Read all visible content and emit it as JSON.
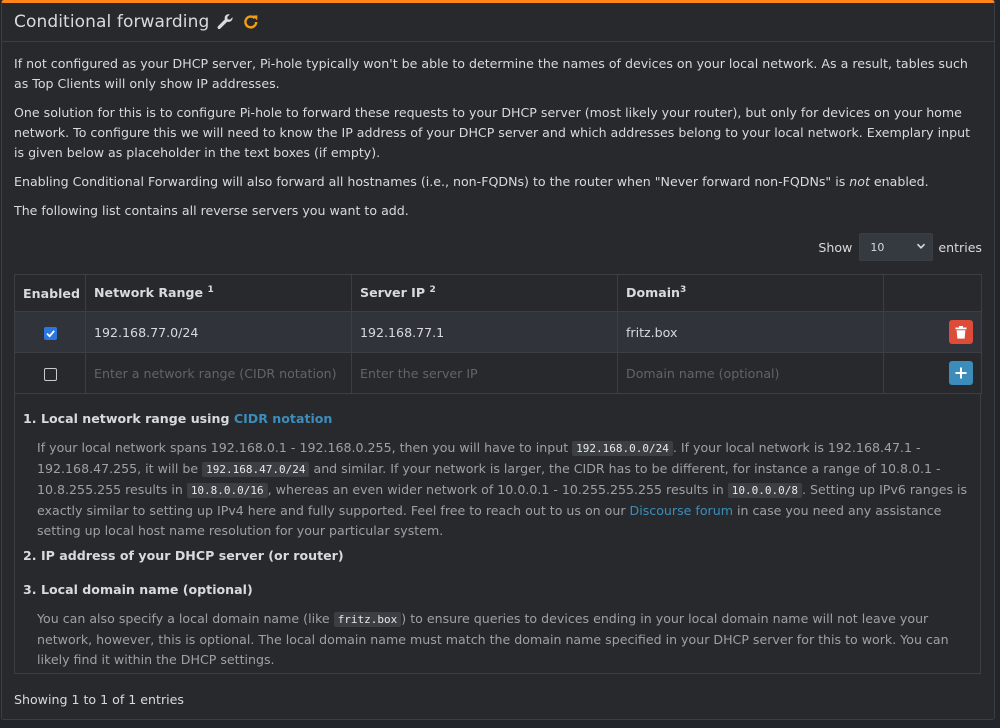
{
  "header": {
    "title": "Conditional forwarding"
  },
  "intro": {
    "p1": "If not configured as your DHCP server, Pi-hole typically won't be able to determine the names of devices on your local network. As a result, tables such as Top Clients will only show IP addresses.",
    "p2": "One solution for this is to configure Pi-hole to forward these requests to your DHCP server (most likely your router), but only for devices on your home network. To configure this we will need to know the IP address of your DHCP server and which addresses belong to your local network. Exemplary input is given below as placeholder in the text boxes (if empty).",
    "p3_before": "Enabling Conditional Forwarding will also forward all hostnames (i.e., non-FQDNs) to the router when \"Never forward non-FQDNs\" is ",
    "p3_em": "not",
    "p3_after": " enabled.",
    "p4": "The following list contains all reverse servers you want to add."
  },
  "length": {
    "show_label": "Show",
    "value": "10",
    "entries_label": "entries"
  },
  "table": {
    "columns": [
      {
        "label": "Enabled",
        "sup": ""
      },
      {
        "label": "Network Range",
        "sup": "1"
      },
      {
        "label": "Server IP",
        "sup": "2"
      },
      {
        "label": "Domain",
        "sup": "3"
      },
      {
        "label": "",
        "sup": ""
      }
    ],
    "row": {
      "enabled": true,
      "network_range": "192.168.77.0/24",
      "server_ip": "192.168.77.1",
      "domain": "fritz.box"
    },
    "new_row": {
      "enabled": false,
      "network_placeholder": "Enter a network range (CIDR notation)",
      "server_placeholder": "Enter the server IP",
      "domain_placeholder": "Domain name (optional)"
    }
  },
  "notes": {
    "n1_num": "1.",
    "n1_title": "Local network range using ",
    "n1_link": "CIDR notation",
    "n1_t1": "If your local network spans 192.168.0.1 - 192.168.0.255, then you will have to input ",
    "n1_c1": "192.168.0.0/24",
    "n1_t2": ". If your local network is 192.168.47.1 - 192.168.47.255, it will be ",
    "n1_c2": "192.168.47.0/24",
    "n1_t3": " and similar. If your network is larger, the CIDR has to be different, for instance a range of 10.8.0.1 - 10.8.255.255 results in ",
    "n1_c3": "10.8.0.0/16",
    "n1_t4": ", whereas an even wider network of 10.0.0.1 - 10.255.255.255 results in ",
    "n1_c4": "10.0.0.0/8",
    "n1_t5": ". Setting up IPv6 ranges is exactly similar to setting up IPv4 here and fully supported. Feel free to reach out to us on our ",
    "n1_link2": "Discourse forum",
    "n1_t6": " in case you need any assistance setting up local host name resolution for your particular system.",
    "n2_num": "2.",
    "n2_title": "IP address of your DHCP server (or router)",
    "n3_num": "3.",
    "n3_title": "Local domain name (optional)",
    "n3_t1": "You can also specify a local domain name (like ",
    "n3_c1": "fritz.box",
    "n3_t2": ") to ensure queries to devices ending in your local domain name will not leave your network, however, this is optional. The local domain name must match the domain name specified in your DHCP server for this to work. You can likely find it within the DHCP settings."
  },
  "footer": {
    "info": "Showing 1 to 1 of 1 entries"
  },
  "colors": {
    "accent": "#ff851b",
    "link": "#3c8dbc",
    "danger": "#dd4b39",
    "checkbox": "#2c76e0"
  },
  "icons": [
    "wrench-icon",
    "refresh-icon",
    "chevron-down-icon",
    "trash-icon",
    "plus-icon",
    "checkmark-icon"
  ]
}
